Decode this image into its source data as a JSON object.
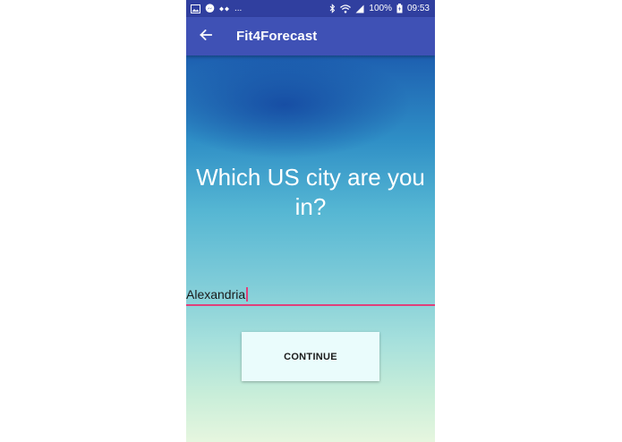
{
  "status_bar": {
    "icons_left": [
      "image-icon",
      "messenger-icon",
      "signal-dots-icon"
    ],
    "overflow": "...",
    "icons_right": [
      "bluetooth-icon",
      "wifi-icon",
      "cell-signal-icon"
    ],
    "battery": "100%",
    "time": "09:53"
  },
  "app_bar": {
    "title": "Fit4Forecast",
    "back_icon": "arrow-left-icon"
  },
  "main": {
    "question": "Which US city are you in?",
    "city_input": {
      "value": "Alexandria"
    },
    "continue_label": "CONTINUE"
  },
  "colors": {
    "status_bar": "#303f9f",
    "app_bar": "#3f51b5",
    "accent": "#e0407a",
    "button_bg": "#eafcfc"
  }
}
